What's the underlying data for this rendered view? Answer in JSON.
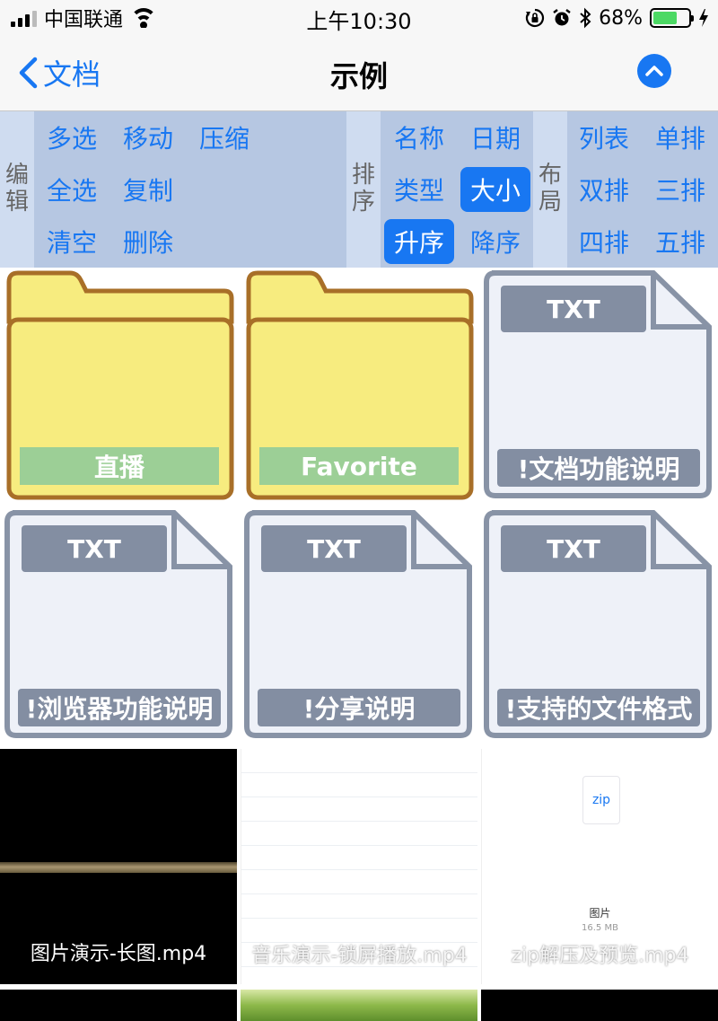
{
  "status_bar": {
    "carrier": "中国联通",
    "time": "上午10:30",
    "battery_percent": "68%",
    "battery_level": 0.68,
    "icons": [
      "signal-icon",
      "wifi-icon",
      "rotation-lock-icon",
      "alarm-icon",
      "bluetooth-icon",
      "battery-icon",
      "charging-icon"
    ]
  },
  "nav": {
    "back_label": "文档",
    "title": "示例",
    "up_icon": "chevron-up-icon"
  },
  "toolbar": {
    "edit_label": [
      "编",
      "辑"
    ],
    "edit_buttons": [
      "多选",
      "移动",
      "压缩",
      "全选",
      "复制",
      "清空",
      "删除"
    ],
    "sort_label": [
      "排",
      "序"
    ],
    "sort_buttons": [
      "名称",
      "日期",
      "类型",
      "大小",
      "升序",
      "降序"
    ],
    "sort_active": [
      "大小",
      "升序"
    ],
    "layout_label": [
      "布",
      "局"
    ],
    "layout_buttons": [
      "列表",
      "单排",
      "双排",
      "三排",
      "四排",
      "五排"
    ]
  },
  "files": [
    {
      "type": "folder",
      "name": "直播"
    },
    {
      "type": "folder",
      "name": "Favorite"
    },
    {
      "type": "txt",
      "tag": "TXT",
      "name": "!文档功能说明"
    },
    {
      "type": "txt",
      "tag": "TXT",
      "name": "!浏览器功能说明"
    },
    {
      "type": "txt",
      "tag": "TXT",
      "name": "!分享说明"
    },
    {
      "type": "txt",
      "tag": "TXT",
      "name": "!支持的文件格式"
    },
    {
      "type": "video",
      "name": "图片演示-长图.mp4"
    },
    {
      "type": "video",
      "name": "音乐演示-锁屏播放.mp4"
    },
    {
      "type": "video",
      "name": "zip解压及预览.mp4",
      "thumb_icon_label": "zip",
      "thumb_caption": "图片",
      "thumb_size": "16.5 MB"
    }
  ],
  "colors": {
    "accent": "#1877f2",
    "toolbar_bg": "#b6c7e2",
    "toolbar_label_bg": "#cfdcf0",
    "folder_fill": "#f7ec7f",
    "folder_border": "#a86f28",
    "folder_name_bar": "#9ccf96",
    "doc_border": "#8893a6",
    "doc_fill": "#eef1f8",
    "doc_tag": "#838ea2"
  }
}
